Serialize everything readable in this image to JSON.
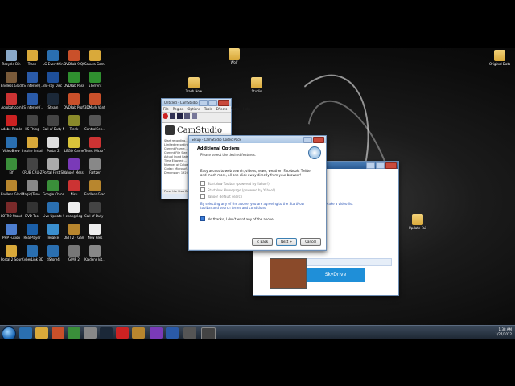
{
  "desktop_icons": [
    {
      "label": "Recycle Bin",
      "color": "#8aa9c9"
    },
    {
      "label": "Endless Gladiators",
      "color": "#7a5b3a"
    },
    {
      "label": "Acrobat.com",
      "color": "#c33"
    },
    {
      "label": "Adobe Reader 9",
      "color": "#c22"
    },
    {
      "label": "VideoBrew",
      "color": "#2a6fb0"
    },
    {
      "label": "Elf",
      "color": "#3b8f3b"
    },
    {
      "label": "Endless Gladiators",
      "color": "#b8862e"
    },
    {
      "label": "LOTRO Standard R...",
      "color": "#7a2a2a"
    },
    {
      "label": "PHP Fusion",
      "color": "#4d7ecf"
    },
    {
      "label": "Portal 2 Soundtrack",
      "color": "#d9a93a"
    },
    {
      "label": "Trash",
      "color": "#d9a93a"
    },
    {
      "label": "IIS Internet(...)",
      "color": "#2a5aa8"
    },
    {
      "label": "IIS Internet(...)",
      "color": "#2a5aa8"
    },
    {
      "label": "IIS Thing",
      "color": "#444"
    },
    {
      "label": "Inspire Instal... - Copy",
      "color": "#d9a93a"
    },
    {
      "label": "CRUB CRU-Z",
      "color": "#444"
    },
    {
      "label": "Magic(Tune...",
      "color": "#888"
    },
    {
      "label": "DVD Tool",
      "color": "#333"
    },
    {
      "label": "RealPlayer",
      "color": "#1b5fa8"
    },
    {
      "label": "CyberLink BD_Advisor",
      "color": "#2a6fb0"
    },
    {
      "label": "LG Everything Trial",
      "color": "#2a6fb0"
    },
    {
      "label": "Blu-ray Disc Tools",
      "color": "#1e4f9a"
    },
    {
      "label": "Steam",
      "color": "#1b2838"
    },
    {
      "label": "Call of Duty Modern ...",
      "color": "#444"
    },
    {
      "label": "Portal 2",
      "color": "#ddd"
    },
    {
      "label": "Portal First Slice",
      "color": "#aaa"
    },
    {
      "label": "Google Chrome",
      "color": "#3a8f3a"
    },
    {
      "label": "Live Update 5",
      "color": "#2a6fb0"
    },
    {
      "label": "TeraIce",
      "color": "#3a8fcf"
    },
    {
      "label": "dStore4",
      "color": "#2a6fb0"
    },
    {
      "label": "DVDFab 9 Qt",
      "color": "#c9502a"
    },
    {
      "label": "DVDFab Passkey 8",
      "color": "#2f8f2f"
    },
    {
      "label": "DVDFab Profile Editor",
      "color": "#c9502a"
    },
    {
      "label": "Trenk",
      "color": "#8a8a2a"
    },
    {
      "label": "LEGO Game",
      "color": "#d9c43a"
    },
    {
      "label": "Yahoo! Messenger",
      "color": "#7a3ab8"
    },
    {
      "label": "Nisu",
      "color": "#c33"
    },
    {
      "label": "changelog",
      "color": "#eee"
    },
    {
      "label": "DBIT 2 - Game",
      "color": "#b8862e"
    },
    {
      "label": "GIMP 2",
      "color": "#777"
    },
    {
      "label": "Sakura Gamep... 2011",
      "color": "#d9a93a"
    },
    {
      "label": "µTorrent",
      "color": "#2f8f2f"
    },
    {
      "label": "3DMark Vantage",
      "color": "#c9502a"
    },
    {
      "label": "ControlCen...",
      "color": "#555"
    },
    {
      "label": "Trend Micro Titanium I...",
      "color": "#c33"
    },
    {
      "label": "Fartzer",
      "color": "#888"
    },
    {
      "label": "Endless Gladiators",
      "color": "#b8862e"
    },
    {
      "label": "Call of Duty Modern ...",
      "color": "#444"
    },
    {
      "label": "New Files",
      "color": "#eee"
    },
    {
      "label": "Kaldens kit...",
      "color": "#888"
    }
  ],
  "desktop_right_icons": [
    {
      "label": "Original Database 1...",
      "color": "#d9a93a"
    },
    {
      "label": "Update Fail",
      "color": "#d9a93a"
    },
    {
      "label": "Wolf",
      "color": "#d9a93a"
    },
    {
      "label": "Trash Now",
      "color": "#d9a93a"
    },
    {
      "label": "Studio",
      "color": "#d9a93a"
    }
  ],
  "camstudio": {
    "title": "Untitled - CamStudio",
    "menu": [
      "File",
      "Region",
      "Options",
      "Tools",
      "Effects",
      "View",
      "Help"
    ],
    "logo": "CamStudio",
    "status_lines": [
      "Start recording...",
      "Limited recording...",
      "Current Frame:...",
      "Current File Size:...",
      "Actual Input Rate:...",
      "Time Elapsed:...",
      "Number of Colors:...",
      "Codec: Microsoft...",
      "Dimension: 1920x..."
    ],
    "footer": "Press the Stop Button"
  },
  "dialog": {
    "title": "Setup - CamStudio Codec Pack",
    "heading": "Additional Options",
    "subheading": "Please select the desired features.",
    "intro": "Easy access to web search, videos, news, weather, Facebook, Twitter and much more, all one click away directly from your browser!",
    "options": [
      {
        "label": "StartNow Toolbar (powered by Yahoo!)",
        "checked": false
      },
      {
        "label": "StartNow Homepage (powered by Yahoo!)",
        "checked": false
      },
      {
        "label": "Yahoo! default search",
        "checked": false
      }
    ],
    "legal": "By selecting any of the above, you are agreeing to the StartNow toolbar and search terms and conditions.",
    "decline": {
      "label": "No thanks, I don't want any of the above.",
      "checked": true
    },
    "buttons": {
      "back": "< Back",
      "next": "Next >",
      "cancel": "Cancel"
    }
  },
  "browser": {
    "note": "Make a video list",
    "tile_text": "SkyDrive"
  },
  "taskbar": {
    "time": "1:38 AM",
    "date": "1/27/2012"
  }
}
